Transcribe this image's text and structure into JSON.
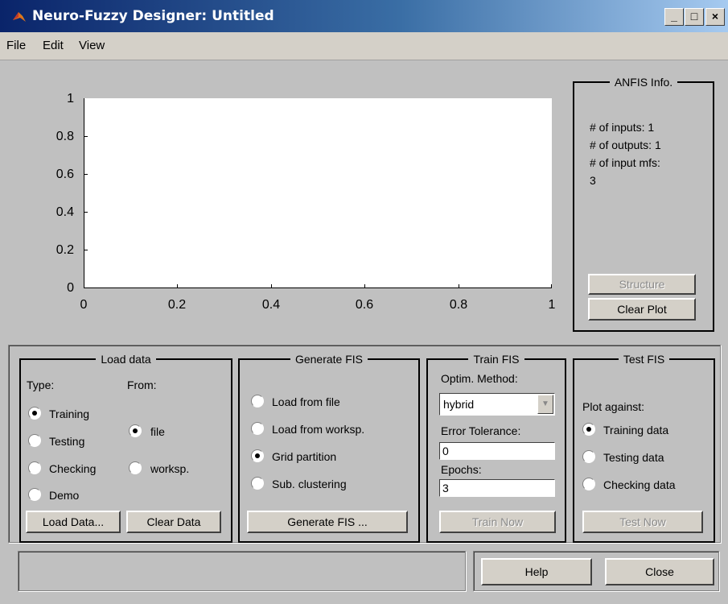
{
  "window": {
    "title": "Neuro-Fuzzy Designer: Untitled",
    "controls": {
      "minimize": "_",
      "maximize": "□",
      "close": "×"
    }
  },
  "menu": [
    "File",
    "Edit",
    "View"
  ],
  "plot": {
    "y_ticks": [
      "0",
      "0.2",
      "0.4",
      "0.6",
      "0.8",
      "1"
    ],
    "x_ticks": [
      "0",
      "0.2",
      "0.4",
      "0.6",
      "0.8",
      "1"
    ]
  },
  "anfis_info": {
    "legend": "ANFIS Info.",
    "inputs": "# of inputs: 1",
    "outputs": "# of outputs: 1",
    "input_mfs": "# of input mfs:",
    "input_mfs_value": "3",
    "structure_button": "Structure",
    "clear_plot_button": "Clear Plot"
  },
  "load_data": {
    "legend": "Load data",
    "type_label": "Type:",
    "from_label": "From:",
    "types": [
      {
        "label": "Training",
        "selected": true
      },
      {
        "label": "Testing",
        "selected": false
      },
      {
        "label": "Checking",
        "selected": false
      },
      {
        "label": "Demo",
        "selected": false
      }
    ],
    "sources": [
      {
        "label": "file",
        "selected": true
      },
      {
        "label": "worksp.",
        "selected": false
      }
    ],
    "load_button": "Load Data...",
    "clear_button": "Clear Data"
  },
  "generate_fis": {
    "legend": "Generate FIS",
    "options": [
      {
        "label": "Load from file",
        "selected": false
      },
      {
        "label": "Load from worksp.",
        "selected": false
      },
      {
        "label": "Grid partition",
        "selected": true
      },
      {
        "label": "Sub. clustering",
        "selected": false
      }
    ],
    "button": "Generate FIS ..."
  },
  "train_fis": {
    "legend": "Train FIS",
    "method_label": "Optim. Method:",
    "method_value": "hybrid",
    "tolerance_label": "Error Tolerance:",
    "tolerance_value": "0",
    "epochs_label": "Epochs:",
    "epochs_value": "3",
    "button": "Train Now"
  },
  "test_fis": {
    "legend": "Test FIS",
    "plot_against_label": "Plot against:",
    "options": [
      {
        "label": "Training data",
        "selected": true
      },
      {
        "label": "Testing data",
        "selected": false
      },
      {
        "label": "Checking data",
        "selected": false
      }
    ],
    "button": "Test Now"
  },
  "footer": {
    "status": "",
    "help_button": "Help",
    "close_button": "Close"
  }
}
